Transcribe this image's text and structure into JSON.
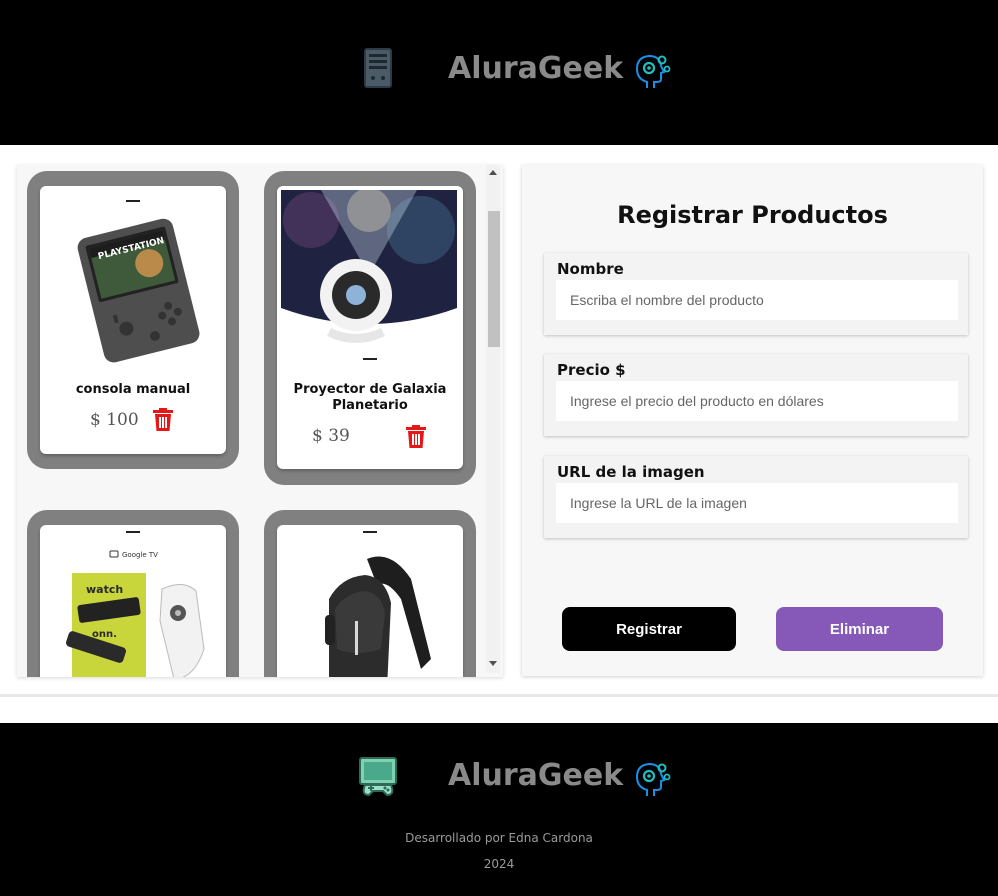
{
  "header": {
    "brand": "AluraGeek"
  },
  "form": {
    "title": "Registrar Productos",
    "fields": [
      {
        "label": "Nombre",
        "placeholder": "Escriba el nombre del producto",
        "value": ""
      },
      {
        "label": "Precio $",
        "placeholder": "Ingrese el precio del producto en dólares",
        "value": ""
      },
      {
        "label": "URL de la imagen",
        "placeholder": "Ingrese la URL de la imagen",
        "value": ""
      }
    ],
    "register_label": "Registrar",
    "delete_label": "Eliminar"
  },
  "products": [
    {
      "name": "consola manual",
      "price": "$ 100",
      "image": "handheld-console-playstation"
    },
    {
      "name": "Proyector de Galaxia Planetario",
      "price": "$ 39",
      "image": "galaxy-projector"
    },
    {
      "name": "",
      "price": "",
      "image": "onn-watch-streaming-stick",
      "image_text": "watch"
    },
    {
      "name": "",
      "price": "",
      "image": "black-sling-backpack"
    }
  ],
  "footer": {
    "brand": "AluraGeek",
    "developer": "Desarrollado por Edna Cardona",
    "year": "2024"
  },
  "colors": {
    "header_bg": "#000000",
    "brand_text": "#8a8a8a",
    "card_frame": "#808080",
    "trash": "#e81717",
    "register_button": "#000000",
    "delete_button": "#8659b8"
  }
}
